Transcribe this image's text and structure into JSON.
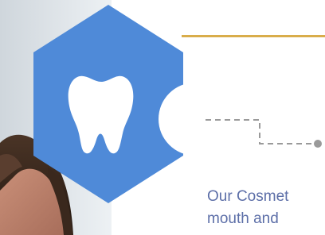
{
  "badge": {
    "icon": "tooth-icon",
    "color": "#4f8ad8"
  },
  "accent": {
    "rule_color": "#d9ad4b",
    "connector_color": "#9a9a9a"
  },
  "photo": {
    "subject": "woman-portrait"
  },
  "description": {
    "line1": "Our Cosmet",
    "line2": "mouth and"
  }
}
